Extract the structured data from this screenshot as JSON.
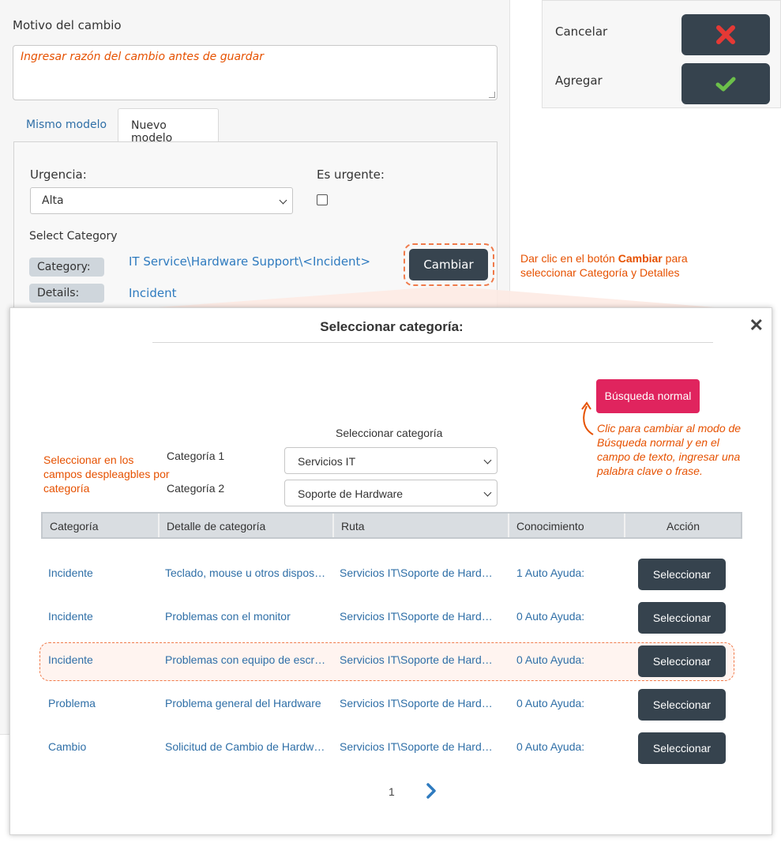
{
  "form": {
    "reason_label": "Motivo del cambio",
    "reason_placeholder": "Ingresar razón del cambio antes de guardar",
    "tabs": [
      {
        "label": "Mismo modelo",
        "active": false
      },
      {
        "label": "Nuevo modelo",
        "active": true
      }
    ],
    "urgency_label": "Urgencia:",
    "urgency_value": "Alta",
    "is_urgent_label": "Es urgente:",
    "is_urgent_checked": false,
    "select_category_label": "Select Category",
    "category_label": "Category:",
    "category_value": "IT Service\\Hardware Support\\<Incident>",
    "details_label": "Details:",
    "details_value": "Incident",
    "change_button": "Cambiar",
    "change_hint_before": "Dar clic en el botón ",
    "change_hint_bold": "Cambiar",
    "change_hint_after": " para seleccionar Categoría y Detalles"
  },
  "actions": {
    "cancel_label": "Cancelar",
    "add_label": "Agregar",
    "cancel_icon": "x-icon",
    "add_icon": "check-icon",
    "cancel_color": "#e53935",
    "add_color": "#6cc04a"
  },
  "modal": {
    "title": "Seleccionar categoría:",
    "close_icon": "close-icon",
    "normal_search_button": "Búsqueda normal",
    "normal_search_hint": "Clic para cambiar al modo de Búsqueda normal y en el campo de texto, ingresar una palabra clave o frase.",
    "select_category_title": "Seleccionar categoría",
    "dropdowns_hint": "Seleccionar en los campos despleagbles por categoría",
    "category1_label": "Categoría 1",
    "category1_value": "Servicios IT",
    "category2_label": "Categoría 2",
    "category2_value": "Soporte de Hardware",
    "table": {
      "headers": [
        "Categoría",
        "Detalle de categoría",
        "Ruta",
        "Conocimiento",
        "Acción"
      ],
      "rows": [
        {
          "category": "Incidente",
          "detail": "Teclado, mouse u otros dispositivos",
          "path": "Servicios IT\\Soporte de Hardware",
          "knowledge": "1 Auto Ayuda:",
          "action": "Seleccionar"
        },
        {
          "category": "Incidente",
          "detail": "Problemas con el monitor",
          "path": "Servicios IT\\Soporte de Hardware",
          "knowledge": "0 Auto Ayuda:",
          "action": "Seleccionar"
        },
        {
          "category": "Incidente",
          "detail": "Problemas con equipo de escritorio",
          "path": "Servicios IT\\Soporte de Hardware",
          "knowledge": "0 Auto Ayuda:",
          "action": "Seleccionar"
        },
        {
          "category": "Problema",
          "detail": "Problema general del Hardware",
          "path": "Servicios IT\\Soporte de Hardware",
          "knowledge": "0 Auto Ayuda:",
          "action": "Seleccionar"
        },
        {
          "category": "Cambio",
          "detail": "Solicitud de Cambio de Hardware",
          "path": "Servicios IT\\Soporte de Hardware",
          "knowledge": "0 Auto Ayuda:",
          "action": "Seleccionar"
        }
      ]
    },
    "pagination": {
      "current_page": "1",
      "next_icon": "chevron-right-icon"
    }
  }
}
